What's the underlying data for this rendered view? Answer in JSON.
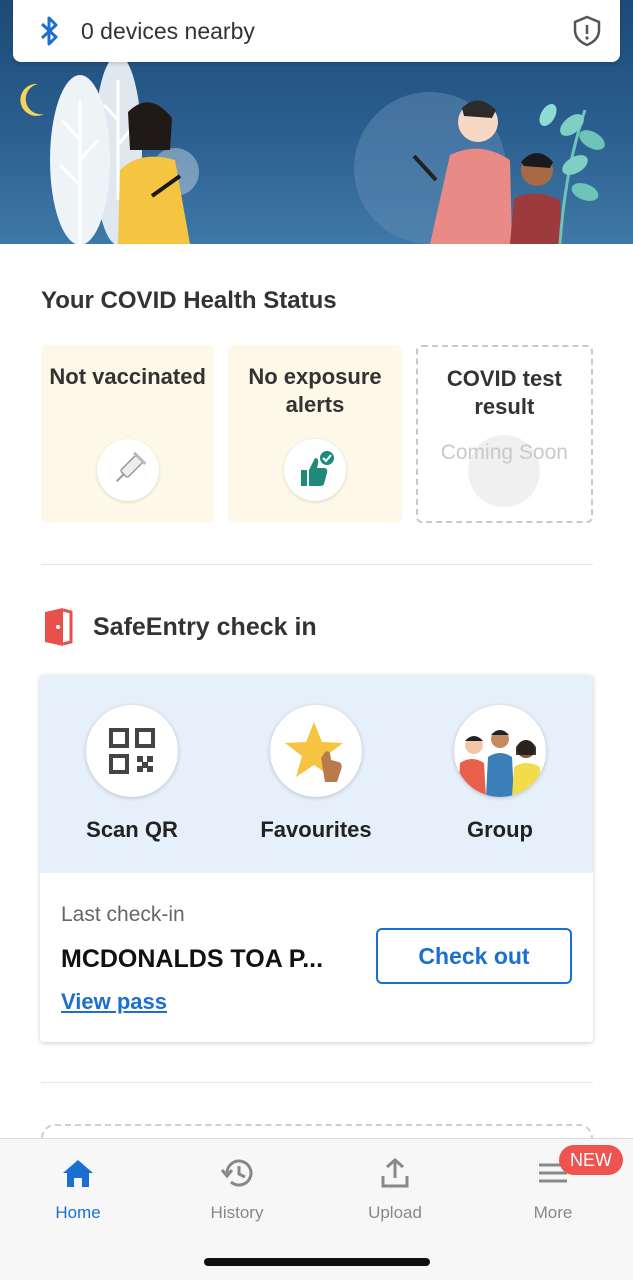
{
  "bluetooth": {
    "status_text": "0 devices nearby",
    "icon": "bluetooth-icon",
    "privacy_icon": "shield-icon"
  },
  "health": {
    "title": "Your COVID Health Status",
    "cards": [
      {
        "label": "Not vaccinated",
        "icon": "syringe-icon"
      },
      {
        "label": "No exposure alerts",
        "icon": "thumbs-up-check-icon"
      },
      {
        "label": "COVID test result",
        "placeholder": "Coming Soon"
      }
    ]
  },
  "safeentry": {
    "title": "SafeEntry check in",
    "actions": [
      {
        "label": "Scan QR",
        "icon": "qr-code-icon"
      },
      {
        "label": "Favourites",
        "icon": "star-icon"
      },
      {
        "label": "Group",
        "icon": "group-icon"
      }
    ],
    "last_checkin_label": "Last check-in",
    "last_checkin_place": "MCDONALDS TOA P...",
    "view_pass": "View pass",
    "checkout": "Check out"
  },
  "tabs": [
    {
      "label": "Home",
      "icon": "home-icon",
      "active": true
    },
    {
      "label": "History",
      "icon": "history-icon"
    },
    {
      "label": "Upload",
      "icon": "upload-icon"
    },
    {
      "label": "More",
      "icon": "menu-icon"
    }
  ],
  "badge": "NEW",
  "colors": {
    "accent": "#1a6fd1",
    "badge": "#ef5350",
    "card_yellow": "#fdf8e8",
    "safeentry_bg": "#e6f0fa",
    "hero": "#2b5f8f"
  }
}
